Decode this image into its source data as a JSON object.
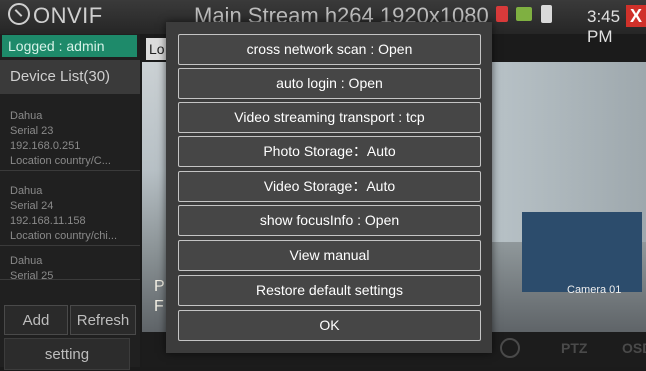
{
  "header": {
    "app_title": "ONVIF",
    "stream_title": "Main Stream h264 1920x1080",
    "time": "3:45 PM",
    "close_label": "X"
  },
  "sidebar": {
    "logged": "Logged : admin",
    "device_list_title": "Device List(30)",
    "devices": [
      {
        "name": "Dahua",
        "serial": "Serial 23",
        "ip": "192.168.0.251",
        "location": "Location country/C..."
      },
      {
        "name": "Dahua",
        "serial": "Serial 24",
        "ip": "192.168.11.158",
        "location": "Location country/chi..."
      },
      {
        "name": "Dahua",
        "serial": "Serial 25"
      }
    ],
    "add_label": "Add",
    "refresh_label": "Refresh",
    "setting_label": "setting"
  },
  "video": {
    "tab_label": "Lo",
    "camera_label": "Camera 01",
    "overlay_line1": "P",
    "overlay_line2": "F"
  },
  "toolbar": {
    "ptz_label": "PTZ",
    "osd_label": "OSD"
  },
  "settings_menu": {
    "items": [
      "cross network scan : Open",
      "auto login    : Open",
      "Video streaming transport : tcp",
      "Photo Storage：Auto",
      "Video Storage：Auto",
      "show focusInfo   : Open",
      "View manual",
      "Restore default settings",
      "OK"
    ]
  },
  "colors": {
    "logged_bg": "#1e8a6a",
    "close_bg": "#d0312a",
    "modal_bg": "#3c3c3c",
    "item_border": "#c4c4c4"
  },
  "icons": [
    "onvif-logo-icon",
    "sd-card-icon",
    "network-icon",
    "battery-icon",
    "close-icon",
    "play-icon"
  ]
}
